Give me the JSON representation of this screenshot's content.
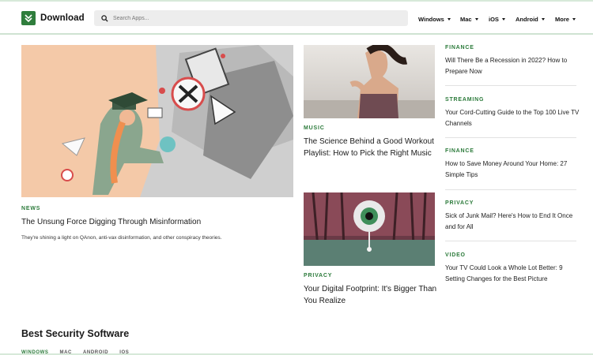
{
  "brand": {
    "name": "Download",
    "accent": "#2f7d3c"
  },
  "search": {
    "placeholder": "Search Apps..."
  },
  "nav": [
    {
      "label": "Windows"
    },
    {
      "label": "Mac"
    },
    {
      "label": "iOS"
    },
    {
      "label": "Android"
    },
    {
      "label": "More"
    }
  ],
  "hero": {
    "category": "NEWS",
    "title": "The Unsung Force Digging Through Misinformation",
    "summary": "They're shining a light on QAnon, anti-vax disinformation, and other conspiracy theories."
  },
  "middle": [
    {
      "category": "MUSIC",
      "title": "The Science Behind a Good Workout Playlist: How to Pick the Right Music"
    },
    {
      "category": "PRIVACY",
      "title": "Your Digital Footprint: It's Bigger Than You Realize"
    }
  ],
  "sidebar": [
    {
      "category": "FINANCE",
      "title": "Will There Be a Recession in 2022? How to Prepare Now"
    },
    {
      "category": "STREAMING",
      "title": "Your Cord-Cutting Guide to the Top 100 Live TV Channels"
    },
    {
      "category": "FINANCE",
      "title": "How to Save Money Around Your Home: 27 Simple Tips"
    },
    {
      "category": "PRIVACY",
      "title": "Sick of Junk Mail? Here's How to End It Once and for All"
    },
    {
      "category": "VIDEO",
      "title": "Your TV Could Look a Whole Lot Better: 9 Setting Changes for the Best Picture"
    }
  ],
  "security": {
    "title": "Best Security Software",
    "tabs": [
      "WINDOWS",
      "MAC",
      "ANDROID",
      "IOS"
    ]
  }
}
